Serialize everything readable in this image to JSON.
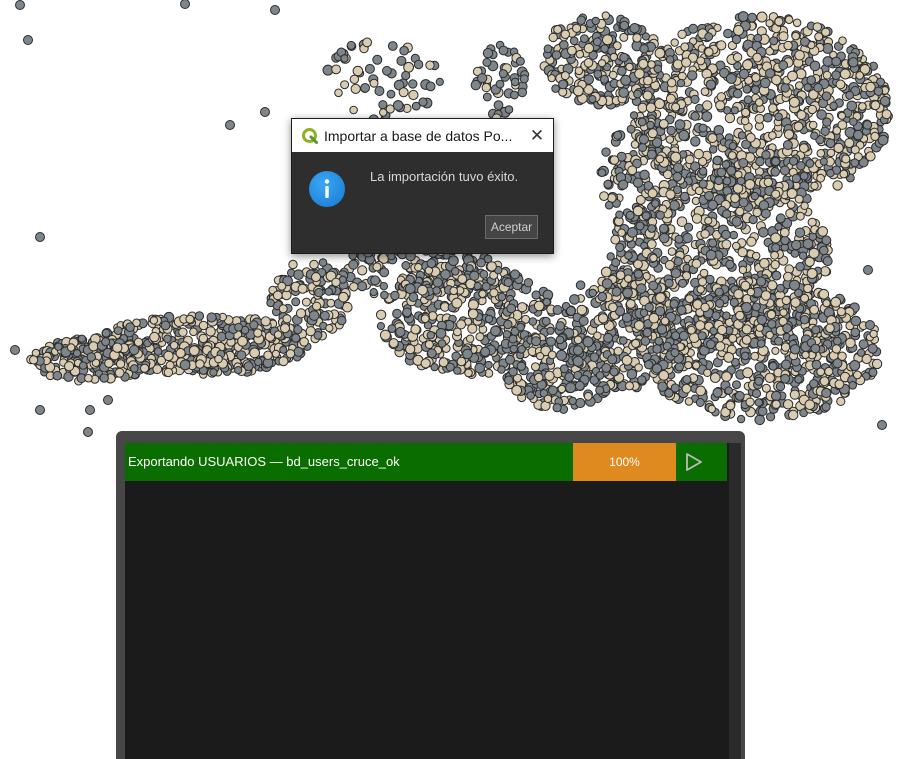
{
  "dialog": {
    "title": "Importar a base de datos Po...",
    "message": "La importación tuvo éxito.",
    "accept_label": "Aceptar",
    "close_glyph": "✕"
  },
  "task_manager": {
    "task": {
      "label": "Exportando USUARIOS — bd_users_cruce_ok",
      "progress_text": "100%",
      "progress": 1.0
    }
  },
  "colors": {
    "point_fill_light": "#d9ccb0",
    "point_fill_gray": "#7e868c",
    "point_stroke": "#2c2c2c",
    "task_row": "#0a6d00",
    "progress": "#df8a1e",
    "info_icon": "#1d86dc"
  },
  "icons": {
    "app": "qgis-icon",
    "info": "info-icon",
    "close": "close-icon",
    "play": "play-icon"
  }
}
